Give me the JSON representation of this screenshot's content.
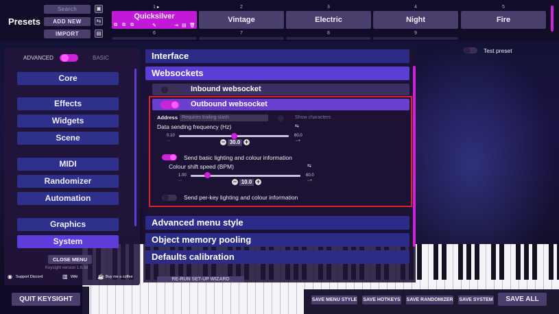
{
  "topbar": {
    "title": "Presets",
    "search_placeholder": "Search",
    "add_new": "ADD NEW",
    "import": "IMPORT",
    "slots": [
      {
        "num": "1",
        "name": "Quicksilver"
      },
      {
        "num": "2",
        "name": "Vintage"
      },
      {
        "num": "3",
        "name": "Electric"
      },
      {
        "num": "4",
        "name": "Night"
      },
      {
        "num": "5",
        "name": "Fire"
      }
    ],
    "slots_row2": [
      "6",
      "7",
      "8",
      "9"
    ]
  },
  "sidebar": {
    "advanced": "ADVANCED",
    "basic": "BASIC",
    "items": [
      "Core",
      "Effects",
      "Widgets",
      "Scene",
      "MIDI",
      "Randomizer",
      "Automation",
      "Graphics",
      "System"
    ],
    "close_menu": "CLOSE MENU",
    "version": "Keysight version 1.6.3d",
    "support_discord": "Support Discord",
    "wiki": "Wiki",
    "coffee": "Buy me a coffee"
  },
  "main": {
    "interface": "Interface",
    "websockets": "Websockets",
    "inbound": "Inbound websocket",
    "outbound": "Outbound websocket",
    "address_label": "Address",
    "address_placeholder": "Requires trailing slash",
    "show_chars": "Show characters",
    "freq_label": "Data sending frequency (Hz)",
    "freq_min": "0.10",
    "freq_max": "60.0",
    "freq_value": "30.0",
    "freq_fraction": 0.5,
    "send_basic": "Send basic lighting and colour information",
    "shift_label": "Colour shift speed (BPM)",
    "shift_min": "1.00",
    "shift_max": "60.0",
    "shift_value": "10.0",
    "shift_fraction": 0.15,
    "send_perkey": "Send per-key lighting and colour information",
    "advanced_menu": "Advanced menu style",
    "object_pool": "Object memory pooling",
    "defaults_cal": "Defaults calibration",
    "rerun": "RE-RUN SET-UP WIZARD"
  },
  "test_preset": "Test preset",
  "bottom": {
    "quit": "QUIT KEYSIGHT",
    "save_menu": "SAVE MENU STYLE",
    "save_hotkeys": "SAVE HOTKEYS",
    "save_randomizer": "SAVE RANDOMIZER",
    "save_system": "SAVE SYSTEM",
    "save_all": "SAVE ALL"
  },
  "colors": {
    "accent": "#cc22d8",
    "nav": "#2f2f8c",
    "nav_selected": "#5e3cd9",
    "highlight_border": "#e0202a"
  }
}
